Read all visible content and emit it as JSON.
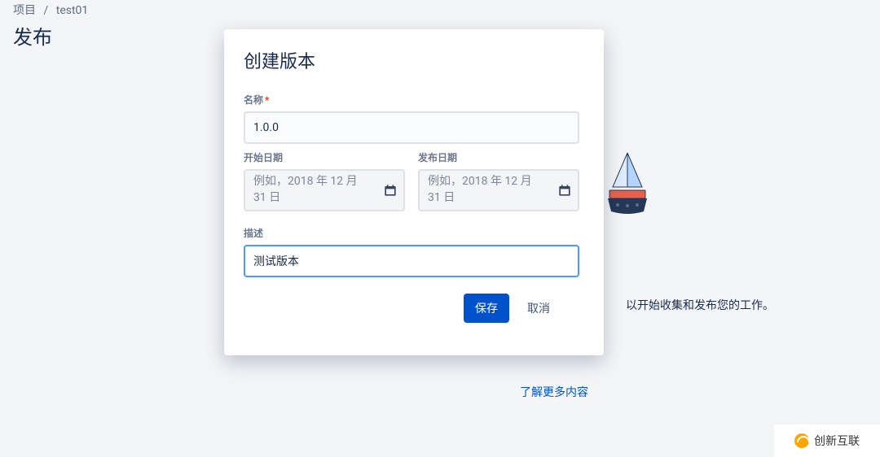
{
  "breadcrumb": {
    "root": "项目",
    "current": "test01"
  },
  "page": {
    "title": "发布"
  },
  "background": {
    "hint_text": "以开始收集和发布您的工作。",
    "learn_more": "了解更多内容"
  },
  "modal": {
    "title": "创建版本",
    "name_label": "名称",
    "name_value": "1.0.0",
    "start_date_label": "开始日期",
    "release_date_label": "发布日期",
    "date_placeholder": "例如，2018 年 12 月 31 日",
    "description_label": "描述",
    "description_value": "测试版本",
    "save_label": "保存",
    "cancel_label": "取消"
  },
  "watermark": {
    "text": "创新互联"
  }
}
